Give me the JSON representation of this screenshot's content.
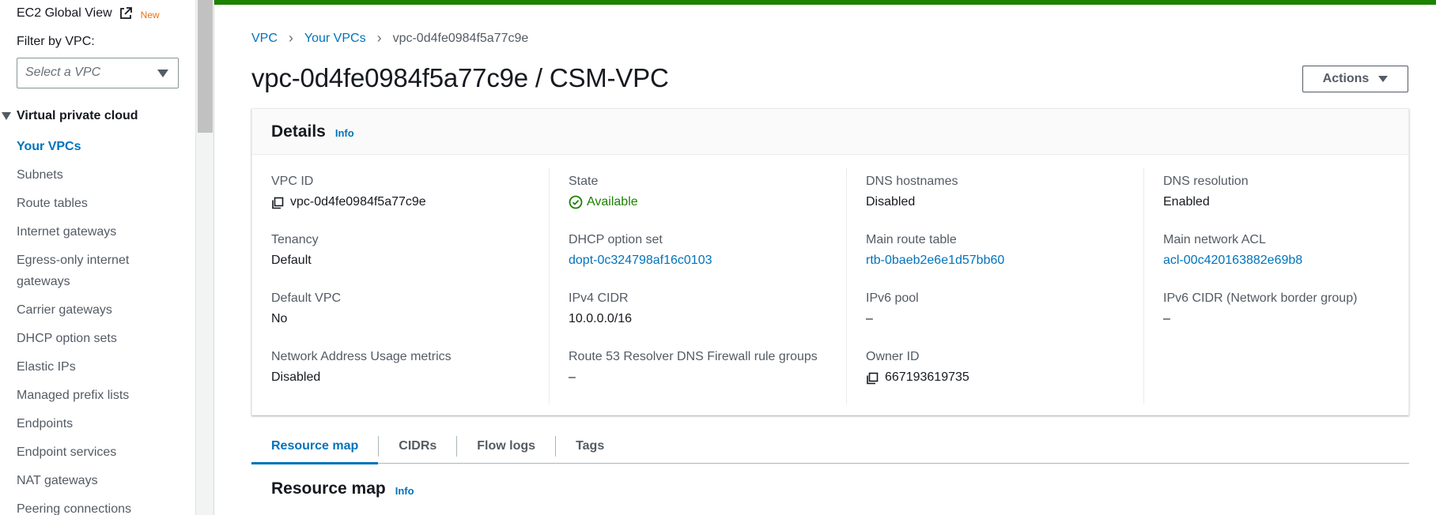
{
  "sidebar": {
    "ec2_global_view": "EC2 Global View",
    "new_badge": "New",
    "filter_label": "Filter by VPC:",
    "select_placeholder": "Select a VPC",
    "section_title": "Virtual private cloud",
    "items": [
      {
        "label": "Your VPCs",
        "active": true
      },
      {
        "label": "Subnets"
      },
      {
        "label": "Route tables"
      },
      {
        "label": "Internet gateways"
      },
      {
        "label": "Egress-only internet gateways"
      },
      {
        "label": "Carrier gateways"
      },
      {
        "label": "DHCP option sets"
      },
      {
        "label": "Elastic IPs"
      },
      {
        "label": "Managed prefix lists"
      },
      {
        "label": "Endpoints"
      },
      {
        "label": "Endpoint services"
      },
      {
        "label": "NAT gateways"
      },
      {
        "label": "Peering connections"
      }
    ]
  },
  "breadcrumb": {
    "vpc": "VPC",
    "your_vpcs": "Your VPCs",
    "current": "vpc-0d4fe0984f5a77c9e"
  },
  "page_title": "vpc-0d4fe0984f5a77c9e / CSM-VPC",
  "actions_label": "Actions",
  "details": {
    "title": "Details",
    "info": "Info",
    "columns": [
      [
        {
          "label": "VPC ID",
          "value": "vpc-0d4fe0984f5a77c9e",
          "kind": "copy"
        },
        {
          "label": "Tenancy",
          "value": "Default"
        },
        {
          "label": "Default VPC",
          "value": "No"
        },
        {
          "label": "Network Address Usage metrics",
          "value": "Disabled"
        }
      ],
      [
        {
          "label": "State",
          "value": "Available",
          "kind": "status"
        },
        {
          "label": "DHCP option set",
          "value": "dopt-0c324798af16c0103",
          "kind": "link"
        },
        {
          "label": "IPv4 CIDR",
          "value": "10.0.0.0/16"
        },
        {
          "label": "Route 53 Resolver DNS Firewall rule groups",
          "value": "–"
        }
      ],
      [
        {
          "label": "DNS hostnames",
          "value": "Disabled"
        },
        {
          "label": "Main route table",
          "value": "rtb-0baeb2e6e1d57bb60",
          "kind": "link"
        },
        {
          "label": "IPv6 pool",
          "value": "–"
        },
        {
          "label": "Owner ID",
          "value": "667193619735",
          "kind": "copy"
        }
      ],
      [
        {
          "label": "DNS resolution",
          "value": "Enabled"
        },
        {
          "label": "Main network ACL",
          "value": "acl-00c420163882e69b8",
          "kind": "link"
        },
        {
          "label": "IPv6 CIDR (Network border group)",
          "value": "–"
        }
      ]
    ]
  },
  "tabs": [
    {
      "label": "Resource map",
      "active": true
    },
    {
      "label": "CIDRs"
    },
    {
      "label": "Flow logs"
    },
    {
      "label": "Tags"
    }
  ],
  "resource_map": {
    "title": "Resource map",
    "info": "Info"
  },
  "colors": {
    "accent": "#0073bb",
    "success": "#1d8102",
    "new_badge": "#ec7211"
  },
  "icons": {
    "external_link": "external-link-icon",
    "copy": "copy-icon",
    "status_ok": "check-circle-icon",
    "dropdown": "caret-down-icon"
  }
}
